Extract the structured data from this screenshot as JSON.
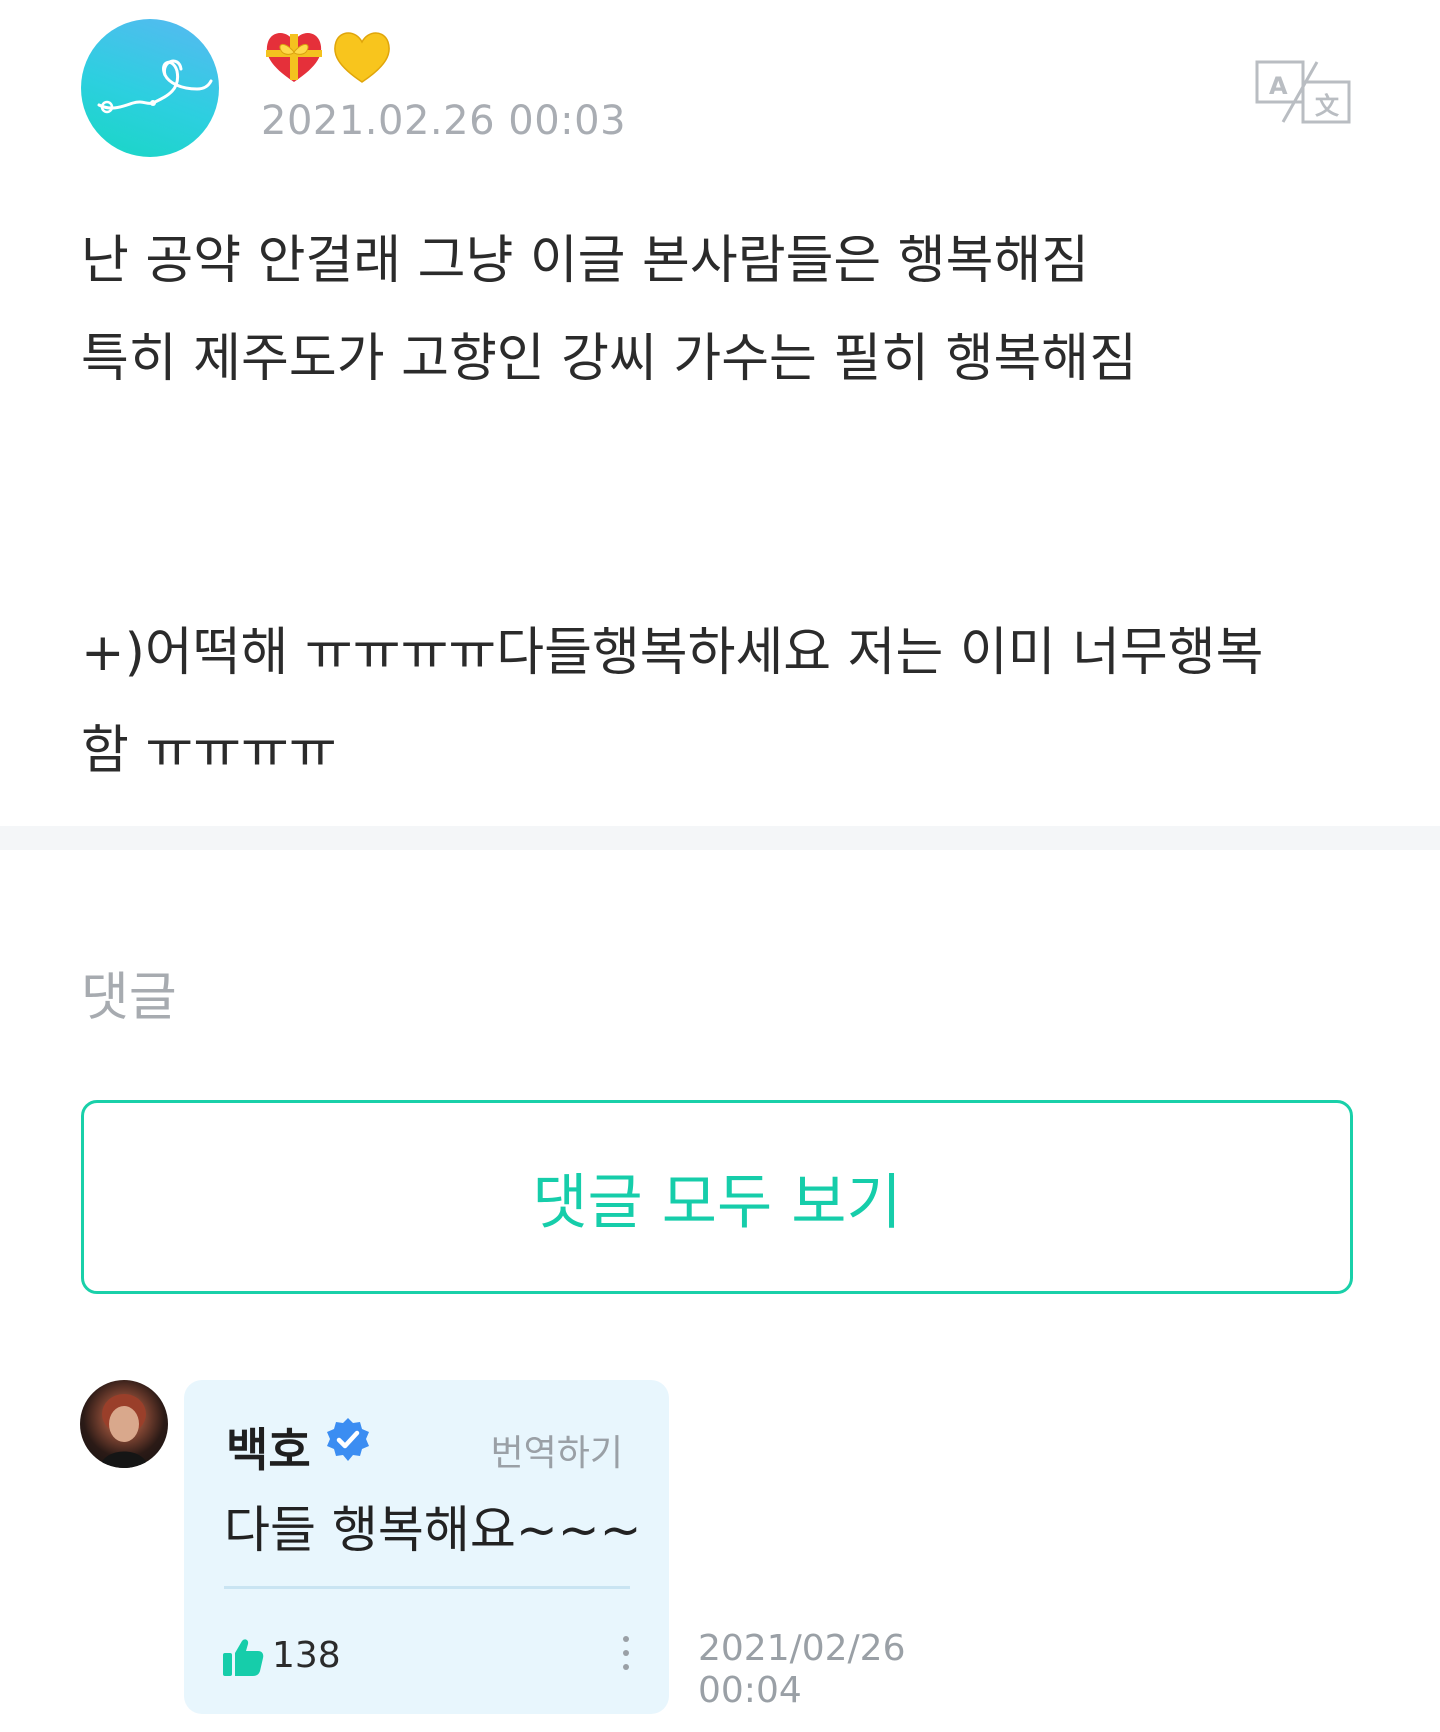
{
  "post": {
    "author_avatar_icon": "heart-ribbon-avatar-icon",
    "badges": [
      "gift-heart-icon",
      "yellow-heart-icon"
    ],
    "date": "2021.02.26 00:03",
    "translate_icon": "translate-icon",
    "body_lines": [
      "난 공약 안걸래 그냥 이글 본사람들은 행복해짐",
      "특히 제주도가 고향인 강씨 가수는 필히 행복해짐",
      "",
      "+)어떡해 ㅠㅠㅠㅠ다들행복하세요 저는 이미 너무행복",
      "함 ㅠㅠㅠㅠ"
    ]
  },
  "comments": {
    "title": "댓글",
    "view_all_label": "댓글 모두 보기",
    "items": [
      {
        "author": "백호",
        "verified": true,
        "translate_label": "번역하기",
        "text": "다들 행복해요~~~",
        "likes": "138",
        "date_line1": "2021/02/26",
        "date_line2": "00:04"
      }
    ]
  },
  "colors": {
    "accent": "#16cdaa",
    "bubble_bg": "#e8f6fd",
    "muted_text": "#a9adb3",
    "verified_blue": "#3b8df2"
  }
}
